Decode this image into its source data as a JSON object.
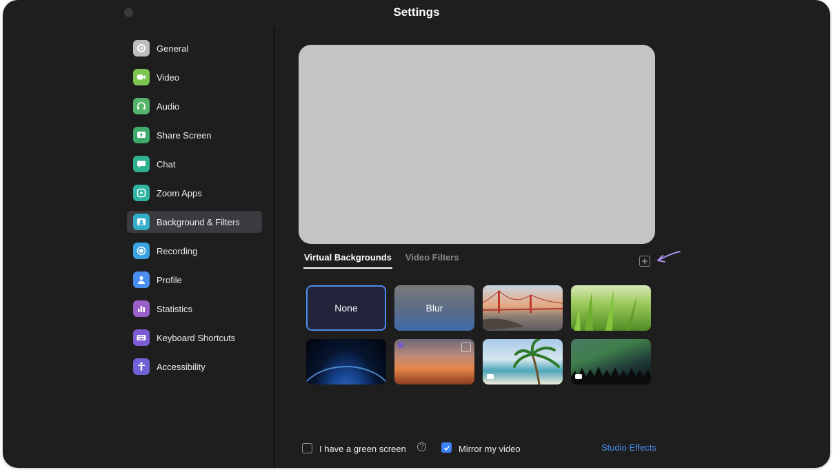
{
  "window": {
    "title": "Settings"
  },
  "sidebar": {
    "items": [
      {
        "label": "General",
        "icon": "gear-icon",
        "color": "#bdbdbd"
      },
      {
        "label": "Video",
        "icon": "video-camera-icon",
        "color": "#7cc551"
      },
      {
        "label": "Audio",
        "icon": "headphones-icon",
        "color": "#55b46c"
      },
      {
        "label": "Share Screen",
        "icon": "share-screen-icon",
        "color": "#3eaa6b"
      },
      {
        "label": "Chat",
        "icon": "chat-bubble-icon",
        "color": "#2fb08e"
      },
      {
        "label": "Zoom Apps",
        "icon": "apps-icon",
        "color": "#2fb3a2"
      },
      {
        "label": "Background & Filters",
        "icon": "person-portrait-icon",
        "color": "#32aec8",
        "selected": true
      },
      {
        "label": "Recording",
        "icon": "record-icon",
        "color": "#3aa4e2"
      },
      {
        "label": "Profile",
        "icon": "person-icon",
        "color": "#4a8ef0"
      },
      {
        "label": "Statistics",
        "icon": "bar-chart-icon",
        "color": "#9a5fc9"
      },
      {
        "label": "Keyboard Shortcuts",
        "icon": "keyboard-icon",
        "color": "#7c5cd4"
      },
      {
        "label": "Accessibility",
        "icon": "accessibility-icon",
        "color": "#6f62d6"
      }
    ]
  },
  "tabs": [
    {
      "label": "Virtual Backgrounds",
      "active": true
    },
    {
      "label": "Video Filters",
      "active": false
    }
  ],
  "add_icon": "plus-square-icon",
  "backgrounds": [
    {
      "label": "None",
      "kind": "none",
      "selected": true
    },
    {
      "label": "Blur",
      "kind": "blur"
    },
    {
      "label": "",
      "kind": "golden-gate-bridge"
    },
    {
      "label": "",
      "kind": "grass"
    },
    {
      "label": "",
      "kind": "earth-from-space"
    },
    {
      "label": "",
      "kind": "sunset"
    },
    {
      "label": "",
      "kind": "palm-beach"
    },
    {
      "label": "",
      "kind": "aurora"
    }
  ],
  "bottom": {
    "green_screen_label": "I have a green screen",
    "green_screen_checked": false,
    "mirror_label": "Mirror my video",
    "mirror_checked": true,
    "studio_effects_label": "Studio Effects"
  },
  "colors": {
    "accent": "#4a8ef0",
    "background": "#1e1e1e",
    "preview": "#c4c4c4",
    "annotation": "#a98fe8"
  }
}
